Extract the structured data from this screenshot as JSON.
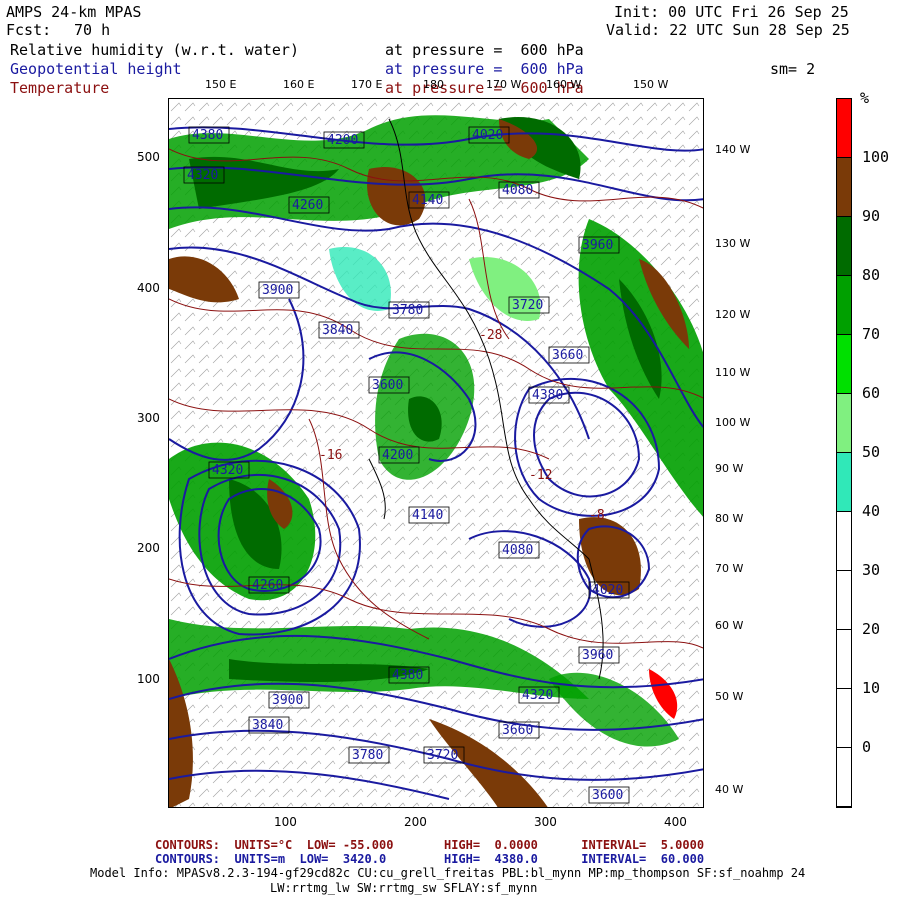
{
  "header": {
    "model": "AMPS 24-km MPAS",
    "fcst_label": "Fcst:",
    "fcst_value": "70 h",
    "init": "Init: 00 UTC Fri 26 Sep 25",
    "valid": "Valid: 22 UTC Sun 28 Sep 25",
    "smoothing": "sm= 2"
  },
  "fields": [
    {
      "name": "Relative humidity (w.r.t. water)",
      "level": "at pressure =  600 hPa",
      "color": "#000000"
    },
    {
      "name": "Geopotential height",
      "level": "at pressure =  600 hPa",
      "color": "#1a1aa0"
    },
    {
      "name": "Temperature",
      "level": "at pressure =  600 hPa",
      "color": "#8b1010"
    }
  ],
  "map": {
    "top_lon_labels": [
      "150 E",
      "160 E",
      "170 E",
      "180",
      "170 W",
      "160 W",
      "150 W"
    ],
    "right_lon_labels": [
      "140 W",
      "130 W",
      "120 W",
      "110 W",
      "100 W",
      "90 W",
      "80 W",
      "70 W",
      "60 W",
      "50 W",
      "40 W"
    ],
    "x_ticks": [
      "100",
      "200",
      "300",
      "400"
    ],
    "y_ticks": [
      "500",
      "400",
      "300",
      "200",
      "100"
    ],
    "height_contour_labels": [
      "4380",
      "4320",
      "4260",
      "4200",
      "4140",
      "4080",
      "4020",
      "3960",
      "3900",
      "3840",
      "3780",
      "3720",
      "3660",
      "3600"
    ],
    "temp_contour_labels": [
      "-28",
      "-12",
      "-16",
      "-8"
    ]
  },
  "colorbar": {
    "unit": "%",
    "labels": [
      "100",
      "90",
      "80",
      "70",
      "60",
      "50",
      "40",
      "30",
      "20",
      "10",
      "0"
    ],
    "colors": [
      "#ff0000",
      "#7a3a08",
      "#006b00",
      "#00a000",
      "#00e000",
      "#80f080",
      "#30e8b8",
      "#ffffff",
      "#ffffff",
      "#ffffff",
      "#ffffff",
      "#ffffff"
    ]
  },
  "footer": {
    "temp_contours": "CONTOURS:  UNITS=°C  LOW= -55.000       HIGH=  0.0000      INTERVAL=  5.0000",
    "height_contours": "CONTOURS:  UNITS=m  LOW=  3420.0        HIGH=  4380.0      INTERVAL=  60.000",
    "model_info": "Model Info: MPASv8.2.3-194-gf29cd82c CU:cu_grell_freitas PBL:bl_mynn MP:mp_thompson SF:sf_noahmp 24",
    "model_info2": "LW:rrtmg_lw SW:rrtmg_sw SFLAY:sf_mynn"
  }
}
